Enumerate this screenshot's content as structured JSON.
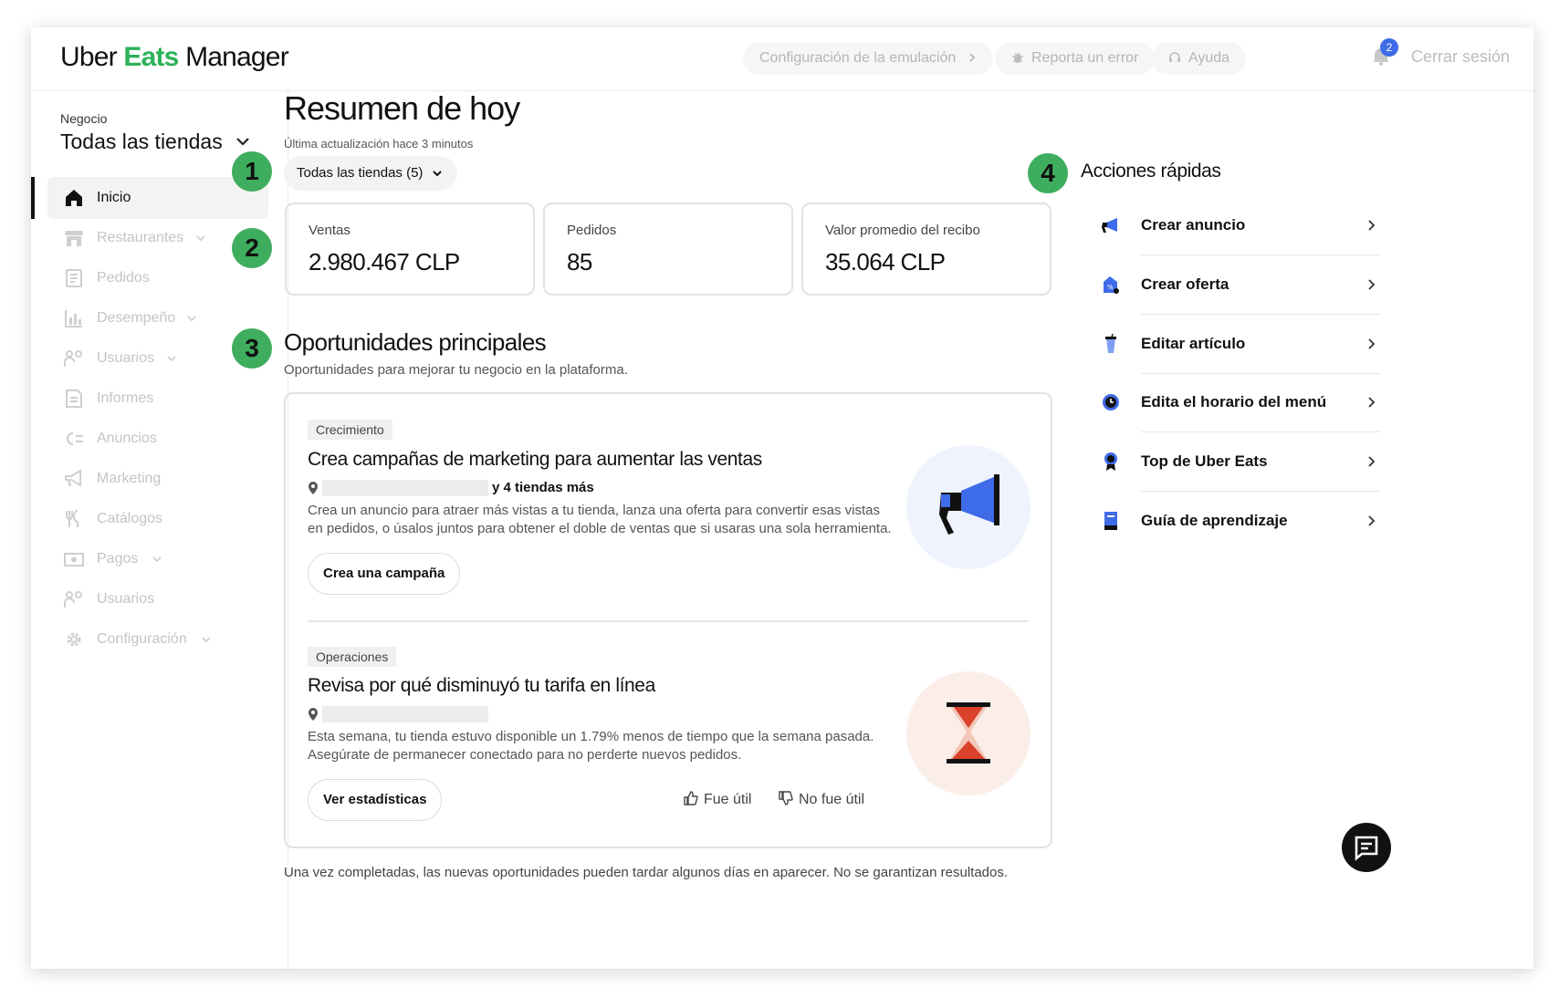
{
  "header": {
    "logo": {
      "part1": "Uber ",
      "part2": "Eats",
      "part3": " Manager"
    },
    "emulation_label": "Configuración de la emulación",
    "report_label": "Reporta un error",
    "help_label": "Ayuda",
    "notification_count": "2",
    "logout_label": "Cerrar sesión"
  },
  "sidebar": {
    "business_label": "Negocio",
    "business_value": "Todas las tiendas",
    "items": [
      {
        "label": "Inicio",
        "icon": "home-icon",
        "active": true
      },
      {
        "label": "Restaurantes",
        "icon": "store-icon",
        "chevron": true
      },
      {
        "label": "Pedidos",
        "icon": "receipt-icon"
      },
      {
        "label": "Desempeño",
        "icon": "bar-chart-icon",
        "chevron": true
      },
      {
        "label": "Usuarios",
        "icon": "users-icon",
        "chevron": true
      },
      {
        "label": "Informes",
        "icon": "report-icon"
      },
      {
        "label": "Anuncios",
        "icon": "ads-icon"
      },
      {
        "label": "Marketing",
        "icon": "megaphone-icon"
      },
      {
        "label": "Catálogos",
        "icon": "utensils-icon"
      },
      {
        "label": "Pagos",
        "icon": "payments-icon",
        "chevron": true
      },
      {
        "label": "Usuarios",
        "icon": "users-icon"
      },
      {
        "label": "Configuración",
        "icon": "gear-icon",
        "chevron": true
      }
    ]
  },
  "badges": [
    "1",
    "2",
    "3",
    "4"
  ],
  "main": {
    "title": "Resumen de hoy",
    "updated": "Última actualización hace 3 minutos",
    "store_filter": "Todas las tiendas (5)",
    "stats": [
      {
        "label": "Ventas",
        "value": "2.980.467 CLP"
      },
      {
        "label": "Pedidos",
        "value": "85"
      },
      {
        "label": "Valor promedio del recibo",
        "value": "35.064 CLP"
      }
    ],
    "opportunities_title": "Oportunidades principales",
    "opportunities_subtitle": "Oportunidades para mejorar tu negocio en la plataforma.",
    "opportunities": [
      {
        "tag": "Crecimiento",
        "title": "Crea campañas de marketing para aumentar las ventas",
        "more_stores": "y 4 tiendas más",
        "description": "Crea un anuncio para atraer más vistas a tu tienda, lanza una oferta para convertir esas vistas en pedidos, o úsalos juntos para obtener el doble de ventas que si usaras una sola herramienta.",
        "button": "Crea una campaña",
        "illustration": "megaphone-illustration",
        "illustration_bg": "#eef3fd"
      },
      {
        "tag": "Operaciones",
        "title": "Revisa por qué disminuyó tu tarifa en línea",
        "description": "Esta semana, tu tienda estuvo disponible un 1.79% menos de tiempo que la semana pasada. Asegúrate de permanecer conectado para no perderte nuevos pedidos.",
        "button": "Ver estadísticas",
        "illustration": "hourglass-illustration",
        "illustration_bg": "#fbeee8"
      }
    ],
    "feedback": {
      "useful": "Fue útil",
      "not_useful": "No fue útil"
    },
    "footnote": "Una vez completadas, las nuevas oportunidades pueden tardar algunos días en aparecer. No se garantizan resultados."
  },
  "quick_actions": {
    "title": "Acciones rápidas",
    "items": [
      {
        "label": "Crear anuncio",
        "icon": "megaphone-icon"
      },
      {
        "label": "Crear oferta",
        "icon": "tag-icon"
      },
      {
        "label": "Editar artículo",
        "icon": "cup-icon"
      },
      {
        "label": "Edita el horario del menú",
        "icon": "clock-icon"
      },
      {
        "label": "Top de Uber Eats",
        "icon": "award-icon"
      },
      {
        "label": "Guía de aprendizaje",
        "icon": "book-icon"
      }
    ]
  },
  "colors": {
    "brand_green": "#3ead5e",
    "eats_green": "#2db259",
    "accent_blue": "#3e6be8",
    "hourglass_red": "#d9412a"
  }
}
